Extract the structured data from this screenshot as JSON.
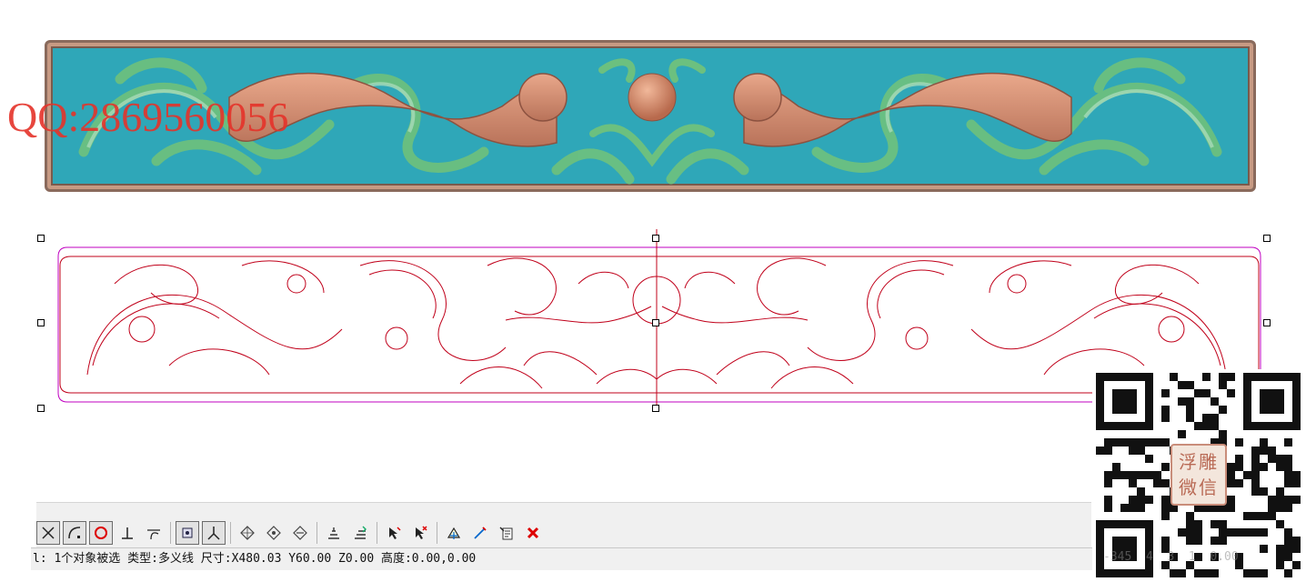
{
  "watermark": {
    "qq_text": "QQ:2869560056"
  },
  "relief_preview": {
    "background_color": "#2fa7b8",
    "frame_color": "#8a6a5c",
    "dragon_color": "#d28f72",
    "scroll_color": "#5fb77a"
  },
  "vector_drawing": {
    "line_color": "#c0001a",
    "boundary_color": "#c000c0"
  },
  "toolbar": {
    "buttons": [
      {
        "icon": "cross-snap-icon",
        "pressed": true
      },
      {
        "icon": "arc-snap-icon",
        "pressed": true
      },
      {
        "icon": "circle-snap-icon",
        "pressed": true
      },
      {
        "icon": "perpendicular-snap-icon",
        "pressed": false
      },
      {
        "icon": "tangent-snap-icon",
        "pressed": false
      },
      {
        "icon": "node-snap-icon",
        "pressed": true
      },
      {
        "icon": "angle-snap-icon",
        "pressed": true
      },
      {
        "icon": "diamond-grid-icon",
        "pressed": false
      },
      {
        "icon": "diamond-grid-2-icon",
        "pressed": false
      },
      {
        "icon": "diamond-grid-3-icon",
        "pressed": false
      },
      {
        "icon": "layer-align-icon",
        "pressed": false
      },
      {
        "icon": "layer-align-2-icon",
        "pressed": false
      },
      {
        "icon": "select-cursor-icon",
        "pressed": false
      },
      {
        "icon": "deselect-cursor-icon",
        "pressed": false
      },
      {
        "icon": "transform-icon",
        "pressed": false
      },
      {
        "icon": "edit-node-icon",
        "pressed": false
      },
      {
        "icon": "properties-icon",
        "pressed": false
      },
      {
        "icon": "delete-icon",
        "pressed": false
      }
    ]
  },
  "status_bar": {
    "text": "l: 1个对象被选 类型:多义线 尺寸:X480.03 Y60.00 Z0.00 高度:0.00,0.00"
  },
  "qr_panel": {
    "stamp_line1": "浮雕",
    "stamp_line2": "微信",
    "coords_text": "-345  4  3  1  0.00"
  }
}
